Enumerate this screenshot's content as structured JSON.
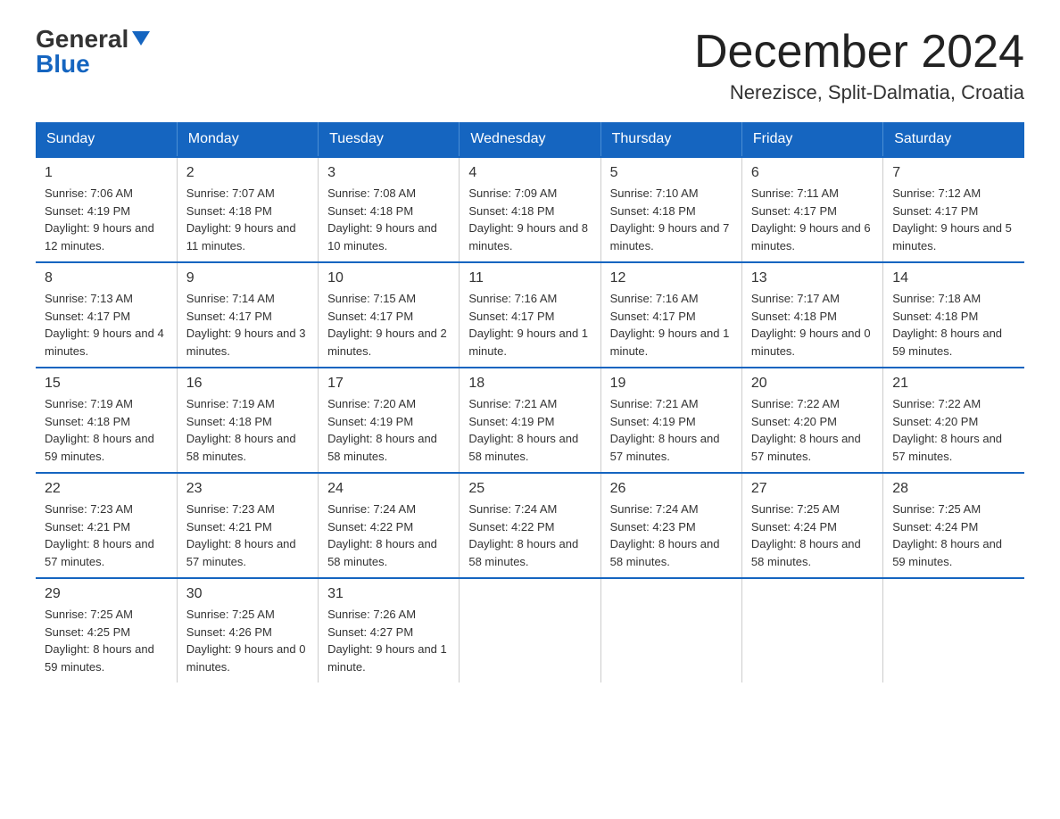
{
  "header": {
    "logo_general": "General",
    "logo_blue": "Blue",
    "month": "December 2024",
    "location": "Nerezisce, Split-Dalmatia, Croatia"
  },
  "days_of_week": [
    "Sunday",
    "Monday",
    "Tuesday",
    "Wednesday",
    "Thursday",
    "Friday",
    "Saturday"
  ],
  "weeks": [
    [
      {
        "day": "1",
        "sunrise": "7:06 AM",
        "sunset": "4:19 PM",
        "daylight": "9 hours and 12 minutes."
      },
      {
        "day": "2",
        "sunrise": "7:07 AM",
        "sunset": "4:18 PM",
        "daylight": "9 hours and 11 minutes."
      },
      {
        "day": "3",
        "sunrise": "7:08 AM",
        "sunset": "4:18 PM",
        "daylight": "9 hours and 10 minutes."
      },
      {
        "day": "4",
        "sunrise": "7:09 AM",
        "sunset": "4:18 PM",
        "daylight": "9 hours and 8 minutes."
      },
      {
        "day": "5",
        "sunrise": "7:10 AM",
        "sunset": "4:18 PM",
        "daylight": "9 hours and 7 minutes."
      },
      {
        "day": "6",
        "sunrise": "7:11 AM",
        "sunset": "4:17 PM",
        "daylight": "9 hours and 6 minutes."
      },
      {
        "day": "7",
        "sunrise": "7:12 AM",
        "sunset": "4:17 PM",
        "daylight": "9 hours and 5 minutes."
      }
    ],
    [
      {
        "day": "8",
        "sunrise": "7:13 AM",
        "sunset": "4:17 PM",
        "daylight": "9 hours and 4 minutes."
      },
      {
        "day": "9",
        "sunrise": "7:14 AM",
        "sunset": "4:17 PM",
        "daylight": "9 hours and 3 minutes."
      },
      {
        "day": "10",
        "sunrise": "7:15 AM",
        "sunset": "4:17 PM",
        "daylight": "9 hours and 2 minutes."
      },
      {
        "day": "11",
        "sunrise": "7:16 AM",
        "sunset": "4:17 PM",
        "daylight": "9 hours and 1 minute."
      },
      {
        "day": "12",
        "sunrise": "7:16 AM",
        "sunset": "4:17 PM",
        "daylight": "9 hours and 1 minute."
      },
      {
        "day": "13",
        "sunrise": "7:17 AM",
        "sunset": "4:18 PM",
        "daylight": "9 hours and 0 minutes."
      },
      {
        "day": "14",
        "sunrise": "7:18 AM",
        "sunset": "4:18 PM",
        "daylight": "8 hours and 59 minutes."
      }
    ],
    [
      {
        "day": "15",
        "sunrise": "7:19 AM",
        "sunset": "4:18 PM",
        "daylight": "8 hours and 59 minutes."
      },
      {
        "day": "16",
        "sunrise": "7:19 AM",
        "sunset": "4:18 PM",
        "daylight": "8 hours and 58 minutes."
      },
      {
        "day": "17",
        "sunrise": "7:20 AM",
        "sunset": "4:19 PM",
        "daylight": "8 hours and 58 minutes."
      },
      {
        "day": "18",
        "sunrise": "7:21 AM",
        "sunset": "4:19 PM",
        "daylight": "8 hours and 58 minutes."
      },
      {
        "day": "19",
        "sunrise": "7:21 AM",
        "sunset": "4:19 PM",
        "daylight": "8 hours and 57 minutes."
      },
      {
        "day": "20",
        "sunrise": "7:22 AM",
        "sunset": "4:20 PM",
        "daylight": "8 hours and 57 minutes."
      },
      {
        "day": "21",
        "sunrise": "7:22 AM",
        "sunset": "4:20 PM",
        "daylight": "8 hours and 57 minutes."
      }
    ],
    [
      {
        "day": "22",
        "sunrise": "7:23 AM",
        "sunset": "4:21 PM",
        "daylight": "8 hours and 57 minutes."
      },
      {
        "day": "23",
        "sunrise": "7:23 AM",
        "sunset": "4:21 PM",
        "daylight": "8 hours and 57 minutes."
      },
      {
        "day": "24",
        "sunrise": "7:24 AM",
        "sunset": "4:22 PM",
        "daylight": "8 hours and 58 minutes."
      },
      {
        "day": "25",
        "sunrise": "7:24 AM",
        "sunset": "4:22 PM",
        "daylight": "8 hours and 58 minutes."
      },
      {
        "day": "26",
        "sunrise": "7:24 AM",
        "sunset": "4:23 PM",
        "daylight": "8 hours and 58 minutes."
      },
      {
        "day": "27",
        "sunrise": "7:25 AM",
        "sunset": "4:24 PM",
        "daylight": "8 hours and 58 minutes."
      },
      {
        "day": "28",
        "sunrise": "7:25 AM",
        "sunset": "4:24 PM",
        "daylight": "8 hours and 59 minutes."
      }
    ],
    [
      {
        "day": "29",
        "sunrise": "7:25 AM",
        "sunset": "4:25 PM",
        "daylight": "8 hours and 59 minutes."
      },
      {
        "day": "30",
        "sunrise": "7:25 AM",
        "sunset": "4:26 PM",
        "daylight": "9 hours and 0 minutes."
      },
      {
        "day": "31",
        "sunrise": "7:26 AM",
        "sunset": "4:27 PM",
        "daylight": "9 hours and 1 minute."
      },
      null,
      null,
      null,
      null
    ]
  ],
  "labels": {
    "sunrise": "Sunrise: ",
    "sunset": "Sunset: ",
    "daylight": "Daylight: "
  }
}
